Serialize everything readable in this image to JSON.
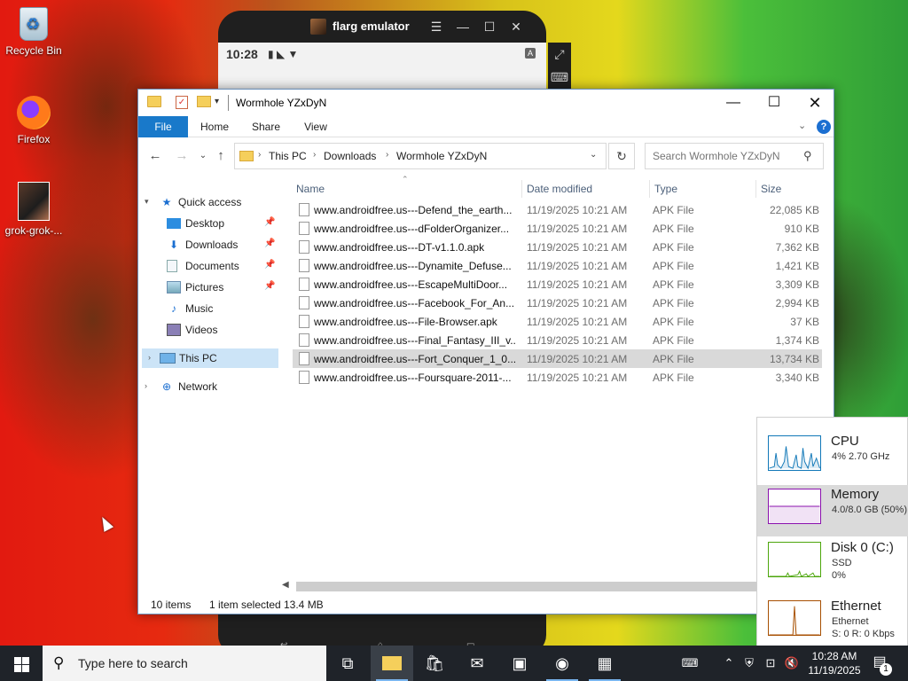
{
  "desktop": {
    "icons": [
      {
        "label": "Recycle Bin"
      },
      {
        "label": "Firefox"
      },
      {
        "label": "grok-grok-..."
      }
    ]
  },
  "emulator": {
    "title": "flarg emulator",
    "time": "10:28",
    "status_icons": "▮ ◣ ▼"
  },
  "explorer": {
    "title": "Wormhole YZxDyN",
    "ribbon_tabs": [
      "File",
      "Home",
      "Share",
      "View"
    ],
    "address": [
      "This PC",
      "Downloads",
      "Wormhole YZxDyN"
    ],
    "search_placeholder": "Search Wormhole YZxDyN",
    "columns": {
      "name": "Name",
      "date": "Date modified",
      "type": "Type",
      "size": "Size"
    },
    "nav": {
      "quick_access": "Quick access",
      "desktop": "Desktop",
      "downloads": "Downloads",
      "documents": "Documents",
      "pictures": "Pictures",
      "music": "Music",
      "videos": "Videos",
      "this_pc": "This PC",
      "network": "Network"
    },
    "files": [
      {
        "name": "www.androidfree.us---Defend_the_earth...",
        "date": "11/19/2025 10:21 AM",
        "type": "APK File",
        "size": "22,085 KB"
      },
      {
        "name": "www.androidfree.us---dFolderOrganizer...",
        "date": "11/19/2025 10:21 AM",
        "type": "APK File",
        "size": "910 KB"
      },
      {
        "name": "www.androidfree.us---DT-v1.1.0.apk",
        "date": "11/19/2025 10:21 AM",
        "type": "APK File",
        "size": "7,362 KB"
      },
      {
        "name": "www.androidfree.us---Dynamite_Defuse...",
        "date": "11/19/2025 10:21 AM",
        "type": "APK File",
        "size": "1,421 KB"
      },
      {
        "name": "www.androidfree.us---EscapeMultiDoor...",
        "date": "11/19/2025 10:21 AM",
        "type": "APK File",
        "size": "3,309 KB"
      },
      {
        "name": "www.androidfree.us---Facebook_For_An...",
        "date": "11/19/2025 10:21 AM",
        "type": "APK File",
        "size": "2,994 KB"
      },
      {
        "name": "www.androidfree.us---File-Browser.apk",
        "date": "11/19/2025 10:21 AM",
        "type": "APK File",
        "size": "37 KB"
      },
      {
        "name": "www.androidfree.us---Final_Fantasy_III_v...",
        "date": "11/19/2025 10:21 AM",
        "type": "APK File",
        "size": "1,374 KB"
      },
      {
        "name": "www.androidfree.us---Fort_Conquer_1_0...",
        "date": "11/19/2025 10:21 AM",
        "type": "APK File",
        "size": "13,734 KB"
      },
      {
        "name": "www.androidfree.us---Foursquare-2011-...",
        "date": "11/19/2025 10:21 AM",
        "type": "APK File",
        "size": "3,340 KB"
      }
    ],
    "selected_index": 8,
    "status": {
      "count": "10 items",
      "selected": "1 item selected",
      "size": "13.4 MB"
    }
  },
  "perf": {
    "cpu": {
      "name": "CPU",
      "sub1": "4% 2.70 GHz"
    },
    "memory": {
      "name": "Memory",
      "sub1": "4.0/8.0 GB (50%)"
    },
    "disk": {
      "name": "Disk 0 (C:)",
      "sub1": "SSD",
      "sub2": "0%"
    },
    "ethernet": {
      "name": "Ethernet",
      "sub1": "Ethernet",
      "sub2": "S: 0 R: 0 Kbps"
    }
  },
  "taskbar": {
    "search_placeholder": "Type here to search",
    "time": "10:28 AM",
    "date": "11/19/2025",
    "notification_count": "1"
  },
  "colors": {
    "accent": "#1979ca",
    "selection": "#cce4f7",
    "taskbar": "#1f2329"
  }
}
